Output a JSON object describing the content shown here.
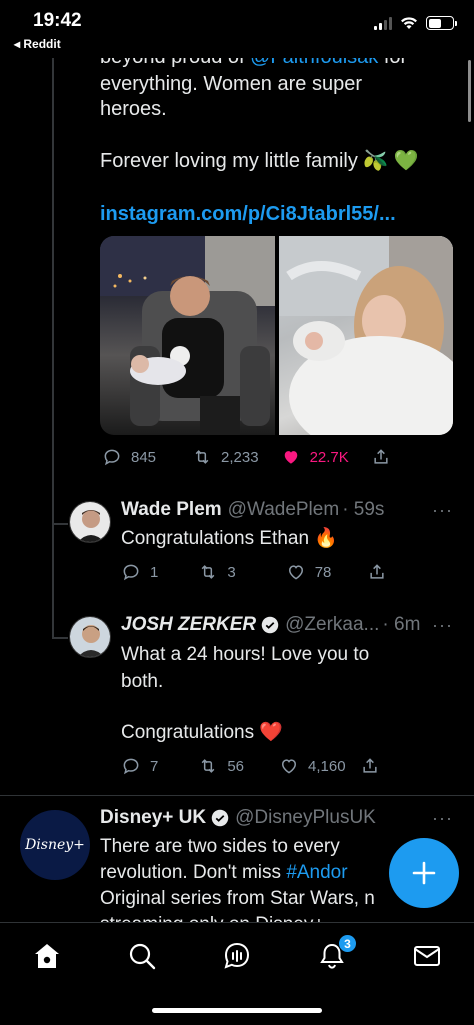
{
  "status_bar": {
    "time": "19:42",
    "back_label": "◂ Reddit"
  },
  "main_tweet": {
    "cut_line_prefix": "beyond proud of ",
    "cut_line_mention": "@Faithfoulsak",
    "cut_line_suffix": " for",
    "line2": "everything. Women are super",
    "line3": "heroes.",
    "line4": "Forever loving my little family 🫒 💚",
    "link": "instagram.com/p/Ci8Jtabrl55/...",
    "stats": {
      "replies": "845",
      "retweets": "2,233",
      "likes": "22.7K"
    },
    "liked": true
  },
  "replies": [
    {
      "name": "Wade Plem",
      "handle": "@WadePlem",
      "time": "· 59s",
      "text": "Congratulations Ethan 🔥",
      "stats": {
        "replies": "1",
        "retweets": "3",
        "likes": "78"
      }
    },
    {
      "name": "JOSH ZERKER",
      "verified": true,
      "handle": "@Zerkaa...",
      "time": "· 6m",
      "text_line1": "What a 24 hours! Love you to",
      "text_line2": "both.",
      "text_line3": "Congratulations ❤️",
      "stats": {
        "replies": "7",
        "retweets": "56",
        "likes": "4,160"
      }
    }
  ],
  "promo_tweet": {
    "avatar_label": "Disney+",
    "name": "Disney+ UK",
    "verified": true,
    "handle": "@DisneyPlusUK",
    "line1": "There are two sides to every",
    "line2_prefix": "revolution. Don't miss ",
    "line2_hashtag": "#Andor",
    "line3": "Original series from Star Wars, n",
    "line4": "streaming only on Disney+"
  },
  "bottom_nav": {
    "items": [
      "home-icon",
      "search-icon",
      "spaces-icon",
      "notifications-icon",
      "messages-icon"
    ],
    "notification_count": "3"
  },
  "more_label": "···",
  "colors": {
    "accent": "#1d9bf0",
    "like": "#f91880",
    "muted": "#71767b",
    "background": "#000000"
  }
}
